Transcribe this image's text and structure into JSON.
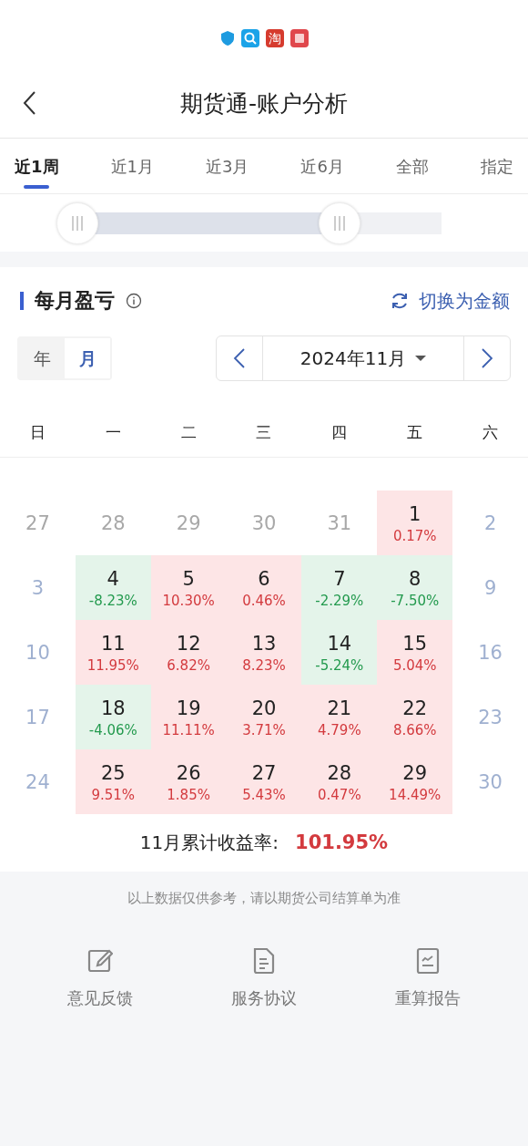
{
  "status_icons": [
    {
      "kind": "shield"
    },
    {
      "kind": "search"
    },
    {
      "kind": "char",
      "text": "淘"
    },
    {
      "kind": "book"
    }
  ],
  "header": {
    "back": true,
    "title": "期货通-账户分析"
  },
  "tabs": [
    {
      "label": "近1周",
      "selected": true
    },
    {
      "label": "近1月",
      "selected": false
    },
    {
      "label": "近3月",
      "selected": false
    },
    {
      "label": "近6月",
      "selected": false
    },
    {
      "label": "全部",
      "selected": false
    },
    {
      "label": "指定",
      "selected": false
    }
  ],
  "range_slider": {
    "level": 0.72
  },
  "section": {
    "title": "每月盈亏",
    "switch_label": "切换为金额"
  },
  "mode_toggle": [
    {
      "label": "年",
      "selected": false
    },
    {
      "label": "月",
      "selected": true
    }
  ],
  "month_picker": {
    "value": "2024年11月"
  },
  "weekdays": [
    "日",
    "一",
    "二",
    "三",
    "四",
    "五",
    "六"
  ],
  "days": [
    {
      "day": "27",
      "kind": "outside"
    },
    {
      "day": "28",
      "kind": "outside"
    },
    {
      "day": "29",
      "kind": "outside"
    },
    {
      "day": "30",
      "kind": "outside"
    },
    {
      "day": "31",
      "kind": "outside"
    },
    {
      "day": "1",
      "kind": "gain",
      "pct": "0.17%"
    },
    {
      "day": "2",
      "kind": "weekend"
    },
    {
      "day": "3",
      "kind": "weekend"
    },
    {
      "day": "4",
      "kind": "loss",
      "pct": "-8.23%"
    },
    {
      "day": "5",
      "kind": "gain",
      "pct": "10.30%"
    },
    {
      "day": "6",
      "kind": "gain",
      "pct": "0.46%"
    },
    {
      "day": "7",
      "kind": "loss",
      "pct": "-2.29%"
    },
    {
      "day": "8",
      "kind": "loss",
      "pct": "-7.50%"
    },
    {
      "day": "9",
      "kind": "weekend"
    },
    {
      "day": "10",
      "kind": "weekend"
    },
    {
      "day": "11",
      "kind": "gain",
      "pct": "11.95%"
    },
    {
      "day": "12",
      "kind": "gain",
      "pct": "6.82%"
    },
    {
      "day": "13",
      "kind": "gain",
      "pct": "8.23%"
    },
    {
      "day": "14",
      "kind": "loss",
      "pct": "-5.24%"
    },
    {
      "day": "15",
      "kind": "gain",
      "pct": "5.04%"
    },
    {
      "day": "16",
      "kind": "weekend"
    },
    {
      "day": "17",
      "kind": "weekend"
    },
    {
      "day": "18",
      "kind": "loss",
      "pct": "-4.06%"
    },
    {
      "day": "19",
      "kind": "gain",
      "pct": "11.11%"
    },
    {
      "day": "20",
      "kind": "gain",
      "pct": "3.71%"
    },
    {
      "day": "21",
      "kind": "gain",
      "pct": "4.79%"
    },
    {
      "day": "22",
      "kind": "gain",
      "pct": "8.66%"
    },
    {
      "day": "23",
      "kind": "weekend"
    },
    {
      "day": "24",
      "kind": "weekend"
    },
    {
      "day": "25",
      "kind": "gain",
      "pct": "9.51%"
    },
    {
      "day": "26",
      "kind": "gain",
      "pct": "1.85%"
    },
    {
      "day": "27",
      "kind": "gain",
      "pct": "5.43%"
    },
    {
      "day": "28",
      "kind": "gain",
      "pct": "0.47%"
    },
    {
      "day": "29",
      "kind": "gain",
      "pct": "14.49%"
    },
    {
      "day": "30",
      "kind": "weekend"
    }
  ],
  "summary": {
    "label": "11月累计收益率:",
    "value": "101.95%"
  },
  "disclaimer": "以上数据仅供参考，请以期货公司结算单为准",
  "actions": [
    {
      "kind": "edit",
      "label": "意见反馈"
    },
    {
      "kind": "doc",
      "label": "服务协议"
    },
    {
      "kind": "report",
      "label": "重算报告"
    }
  ]
}
